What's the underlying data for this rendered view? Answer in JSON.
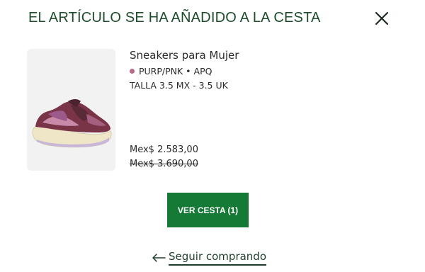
{
  "modal": {
    "title": "EL ARTÍCULO SE HA AÑADIDO A LA CESTA",
    "close_icon": "close-icon"
  },
  "product": {
    "name": "Sneakers para Mujer",
    "color_code": "PURP/PNK • APQ",
    "color_swatch": "#b86a86",
    "size": "TALLA 3.5 MX - 3.5 UK",
    "price": "Mex$ 2.583,00",
    "original_price": "Mex$ 3.690,00",
    "image_icon": "sneaker-image"
  },
  "actions": {
    "view_cart_label": "VER CESTA (1)",
    "continue_label": "Seguir comprando",
    "continue_icon": "arrow-left-icon"
  },
  "colors": {
    "title": "#1d4d2b",
    "button": "#157a36",
    "link": "#1d3e2a"
  }
}
